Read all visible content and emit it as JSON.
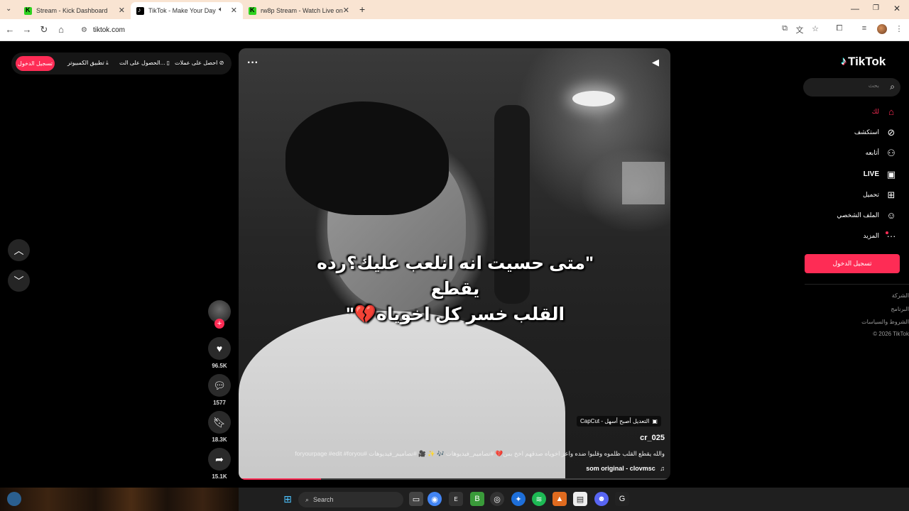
{
  "browser": {
    "tabs": [
      {
        "title": "Stream - Kick Dashboard",
        "icon": "kick-icon"
      },
      {
        "title": "TikTok - Make Your Day",
        "icon": "tiktok-icon"
      },
      {
        "title": "rw8p Stream - Watch Live on K",
        "icon": "kick-icon"
      }
    ],
    "url": "tiktok.com"
  },
  "topbar": {
    "login": "تسجيل الدخول",
    "desktop_app": "تطبيق الكمبيوتر",
    "get_app": "الحصول على الت...",
    "coins": "احصل على عملات"
  },
  "actions": {
    "likes": "96.5K",
    "comments": "1577",
    "saves": "18.3K",
    "shares": "15.1K"
  },
  "video": {
    "caption_line1": "\"متى حسيت انه انلعب عليك؟رده يقطع",
    "caption_line2": "القلب خسر كل اخوياه💔\"",
    "capcut_badge": "CapCut - التعديل أصبح أسهل",
    "author": "cr_025",
    "description": "والله يقطع القلب ظلموه وقلبوا ضده واعز اخوياه صدقهم اخخ بس💔 #تصاميم_فيديوهات 🎶 ✨ 🎥 #تصاميم_فيديوهات #foryourpage #edit #foryou",
    "music": "som original - clovmsc",
    "progress": 0.19
  },
  "taskbar": {
    "search": "Search"
  },
  "sidebar": {
    "logo": "TikTok",
    "search_placeholder": "بحث",
    "nav": [
      {
        "label": "لك",
        "icon": "home-icon"
      },
      {
        "label": "استكشف",
        "icon": "compass-icon"
      },
      {
        "label": "أتابعه",
        "icon": "following-icon"
      },
      {
        "label": "LIVE",
        "icon": "live-icon"
      },
      {
        "label": "تحميل",
        "icon": "upload-icon"
      },
      {
        "label": "الملف الشخصي",
        "icon": "profile-icon"
      },
      {
        "label": "المزيد",
        "icon": "more-icon"
      }
    ],
    "login": "تسجيل الدخول",
    "footer": [
      "الشركة",
      "البرنامج",
      "الشروط والسياسات",
      "© 2026 TikTok"
    ]
  },
  "colors": {
    "accent": "#fe2c55",
    "tabbar": "#f9e4d2",
    "background": "#000000"
  }
}
